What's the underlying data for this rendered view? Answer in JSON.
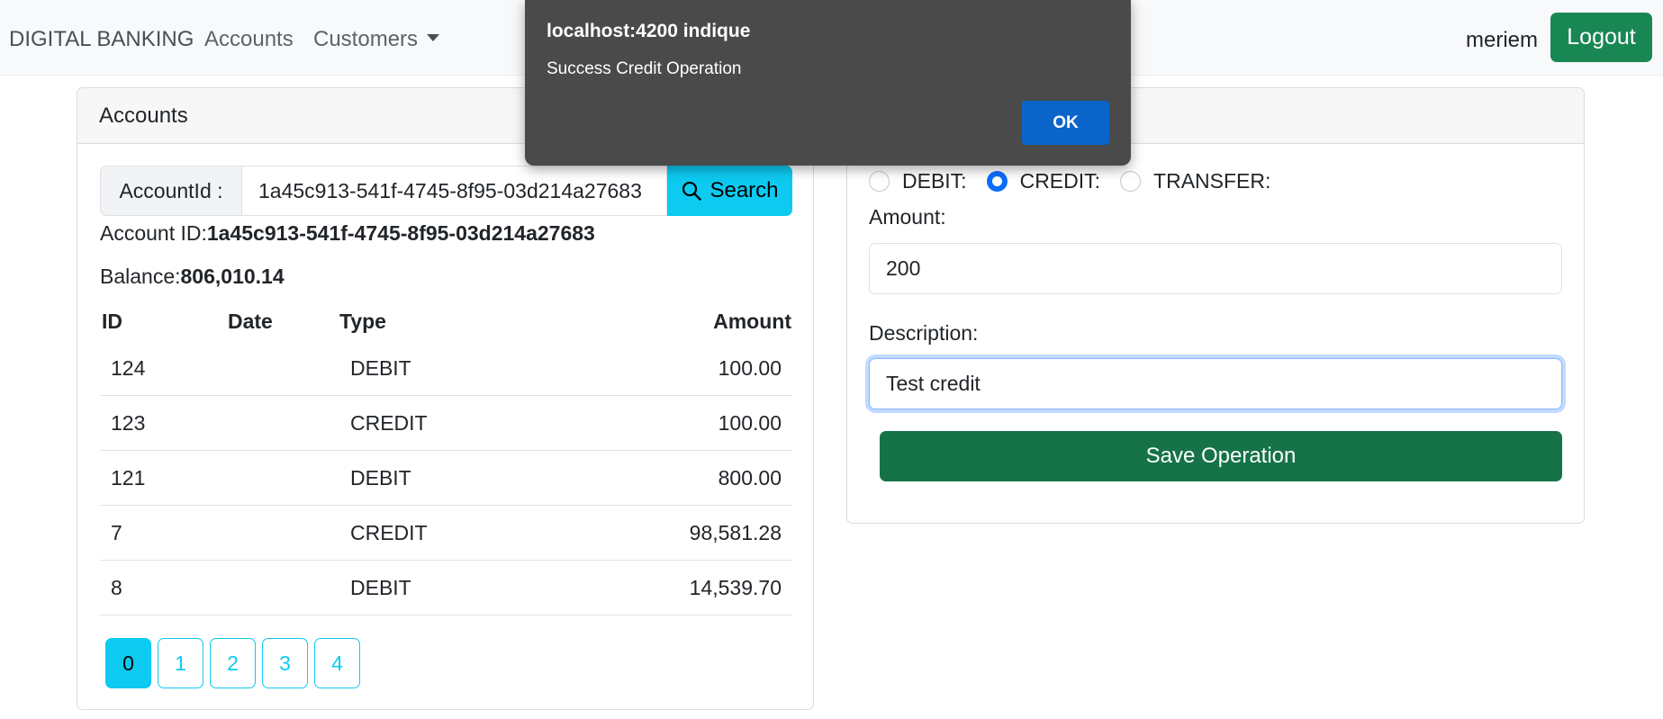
{
  "navbar": {
    "brand": "DIGITAL BANKING",
    "accounts_link": "Accounts",
    "customers_link": "Customers",
    "username": "meriem",
    "logout_label": "Logout"
  },
  "accounts_card": {
    "title": "Accounts",
    "search": {
      "prefix": "AccountId :",
      "value": "1a45c913-541f-4745-8f95-03d214a27683",
      "button_label": "Search"
    },
    "account_id_label": "Account ID:",
    "account_id_value": "1a45c913-541f-4745-8f95-03d214a27683",
    "balance_label": "Balance:",
    "balance_value": "806,010.14",
    "table": {
      "headers": [
        "ID",
        "Date",
        "Type",
        "Amount"
      ],
      "rows": [
        {
          "id": "124",
          "date": "",
          "type": "DEBIT",
          "amount": "100.00"
        },
        {
          "id": "123",
          "date": "",
          "type": "CREDIT",
          "amount": "100.00"
        },
        {
          "id": "121",
          "date": "",
          "type": "DEBIT",
          "amount": "800.00"
        },
        {
          "id": "7",
          "date": "",
          "type": "CREDIT",
          "amount": "98,581.28"
        },
        {
          "id": "8",
          "date": "",
          "type": "DEBIT",
          "amount": "14,539.70"
        }
      ]
    },
    "pages": [
      "0",
      "1",
      "2",
      "3",
      "4"
    ],
    "active_page": "0"
  },
  "operations_card": {
    "radio_options": [
      "DEBIT:",
      "CREDIT:",
      "TRANSFER:"
    ],
    "selected_option": "CREDIT:",
    "amount_label": "Amount:",
    "amount_value": "200",
    "description_label": "Description:",
    "description_value": "Test credit",
    "save_label": "Save Operation"
  },
  "dialog": {
    "title": "localhost:4200 indique",
    "message": "Success Credit Operation",
    "ok_label": "OK"
  },
  "colors": {
    "primary": "#0d6efd",
    "success": "#198754",
    "info": "#0dcaf0",
    "dialog_bg": "#4a4a4a"
  }
}
